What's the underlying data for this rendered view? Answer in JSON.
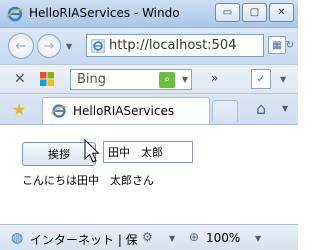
{
  "window": {
    "title": "HelloRIAServices - Windo"
  },
  "caption": {
    "minimize": "▭",
    "maximize": "▢",
    "close": "✕"
  },
  "nav": {
    "address": "http://localhost:504"
  },
  "toolbar": {
    "search_value": "Bing",
    "chevron": "»"
  },
  "tabs": [
    {
      "label": "HelloRIAServices"
    }
  ],
  "app": {
    "button_label": "挨拶",
    "name_value": "田中　太郎",
    "result_text": "こんにちは田中　太郎さん"
  },
  "status": {
    "zone": "インターネット | 保",
    "zoom": "100%"
  },
  "colors": {
    "accent": "#3a78c2",
    "search_go": "#6abf3d"
  }
}
